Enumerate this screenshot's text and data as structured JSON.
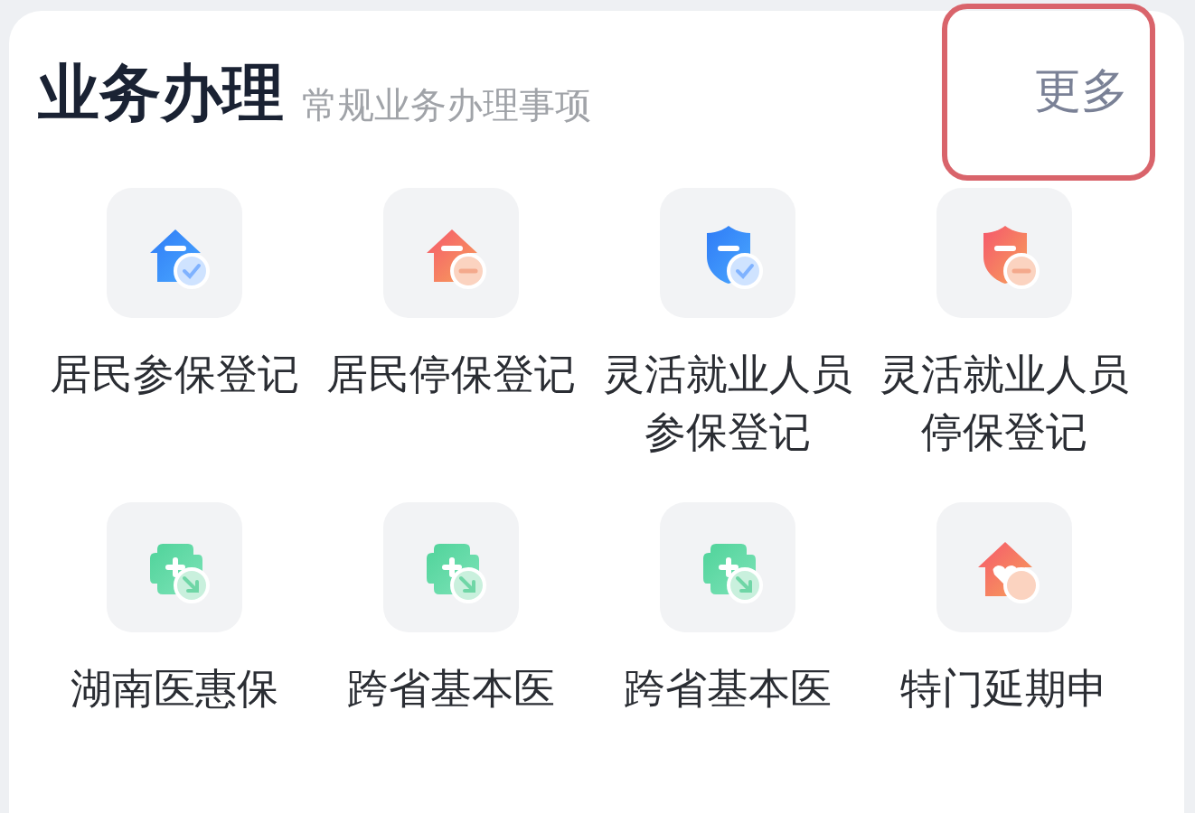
{
  "section": {
    "title": "业务办理",
    "subtitle": "常规业务办理事项",
    "more": {
      "label": "更多",
      "highlighted": true
    }
  },
  "items": [
    {
      "label": "居民参保登记",
      "kind": "house-check"
    },
    {
      "label": "居民停保登记",
      "kind": "house-minus"
    },
    {
      "label": "灵活就业人员参保登记",
      "kind": "shield-check"
    },
    {
      "label": "灵活就业人员停保登记",
      "kind": "shield-minus"
    },
    {
      "label": "湖南医惠保",
      "kind": "cross-arrow"
    },
    {
      "label": "跨省基本医",
      "kind": "cross-arrow"
    },
    {
      "label": "跨省基本医",
      "kind": "cross-arrow"
    },
    {
      "label": "特门延期申",
      "kind": "heart-house"
    }
  ]
}
